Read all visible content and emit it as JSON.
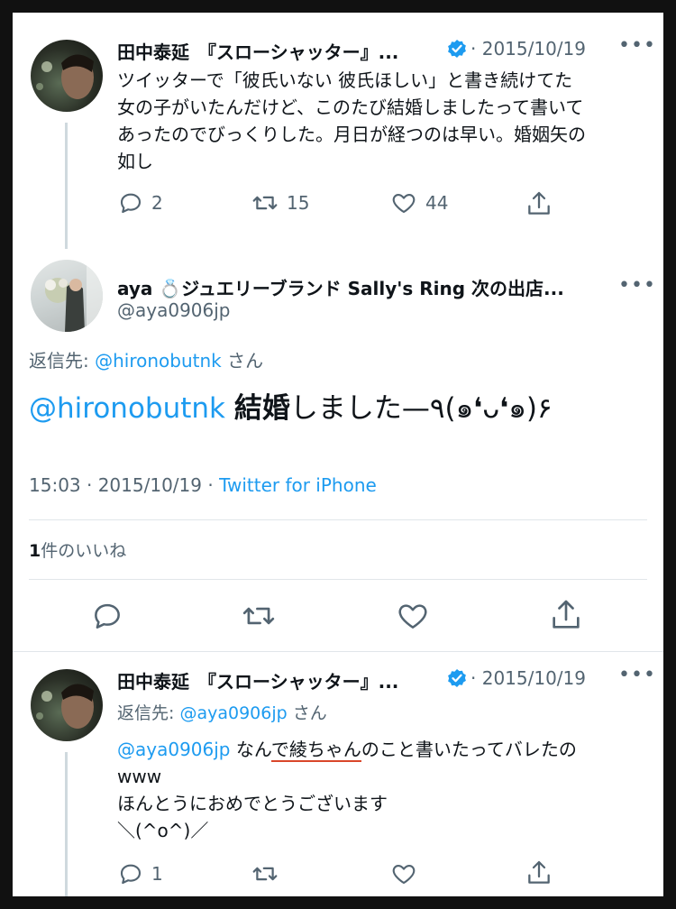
{
  "tweet1": {
    "name": "田中泰延　『スローシャッター』...",
    "date": "· 2015/10/19",
    "text_lines": [
      "ツイッターで「彼氏いない 彼氏ほしい」と書き続けてた",
      "女の子がいたんだけど、このたび結婚しましたって書いて",
      "あったのでびっくりした。月日が経つのは早い。婚姻矢の",
      "如し"
    ],
    "replies": "2",
    "retweets": "15",
    "likes": "44"
  },
  "tweet2": {
    "name": "aya 💍ジュエリーブランド Sally's Ring 次の出店...",
    "handle": "@aya0906jp",
    "reply_to_label": "返信先: ",
    "reply_to_handle": "@hironobutnk",
    "reply_to_suffix": " さん",
    "mention": "@hironobutnk",
    "text_bold": "結婚",
    "text_rest": "しました—٩(๑❛ᴗ❛๑)۶",
    "time": "15:03 · 2015/10/19 · ",
    "source": "Twitter for iPhone",
    "likes_count": "1",
    "likes_label": "件のいいね"
  },
  "tweet3": {
    "name": "田中泰延　『スローシャッター』...",
    "date": "· 2015/10/19",
    "reply_to_label": "返信先: ",
    "reply_to_handle": "@aya0906jp",
    "reply_to_suffix": " さん",
    "mention": "@aya0906jp",
    "text_a": " なん",
    "text_underlined": "で綾ちゃん",
    "text_b": "のこと書いたってバレたの",
    "line2": "www",
    "line3": "ほんとうにおめでとうございます",
    "line4": "＼(^o^)／",
    "replies": "1",
    "underline_color": "#d9472b"
  }
}
